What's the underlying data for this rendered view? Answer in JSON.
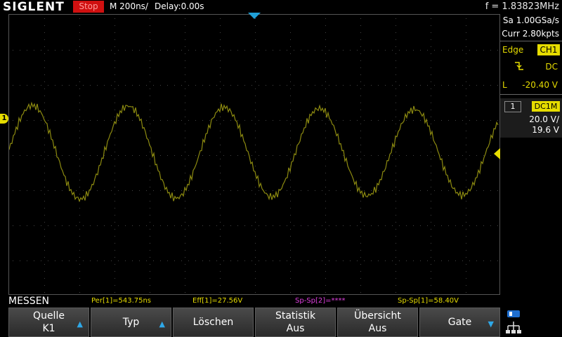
{
  "header": {
    "brand": "SIGLENT",
    "run_state": "Stop",
    "timebase": "M 200ns/",
    "delay": "Delay:0.00s",
    "frequency": "f = 1.83823MHz"
  },
  "acquisition": {
    "sample_rate": "Sa 1.00GSa/s",
    "memory": "Curr 2.80kpts"
  },
  "trigger": {
    "type": "Edge",
    "source": "CH1",
    "coupling": "DC",
    "level_label": "L",
    "level": "-20.40 V"
  },
  "channel": {
    "number": "1",
    "coupling_impedance": "DC1M",
    "scale": "20.0 V/",
    "offset": "19.6 V"
  },
  "markers": {
    "ch1": "1"
  },
  "measure": {
    "title": "MESSEN",
    "items": [
      {
        "text": "Per[1]=543.75ns"
      },
      {
        "text": "Eff[1]=27.56V"
      },
      {
        "text": "Sp-Sp[2]=****"
      },
      {
        "text": "Sp-Sp[1]=58.40V"
      }
    ]
  },
  "softkeys": [
    {
      "line1": "Quelle",
      "line2": "K1"
    },
    {
      "line1": "Typ",
      "line2": ""
    },
    {
      "line1": "Löschen",
      "line2": ""
    },
    {
      "line1": "Statistik",
      "line2": "Aus"
    },
    {
      "line1": "Übersicht",
      "line2": "Aus"
    },
    {
      "line1": "Gate",
      "line2": ""
    }
  ],
  "colors": {
    "trace": "#8c8a10",
    "channel1": "#e6dc00",
    "stop": "#d01010",
    "trigger_marker": "#1fa0d8"
  }
}
